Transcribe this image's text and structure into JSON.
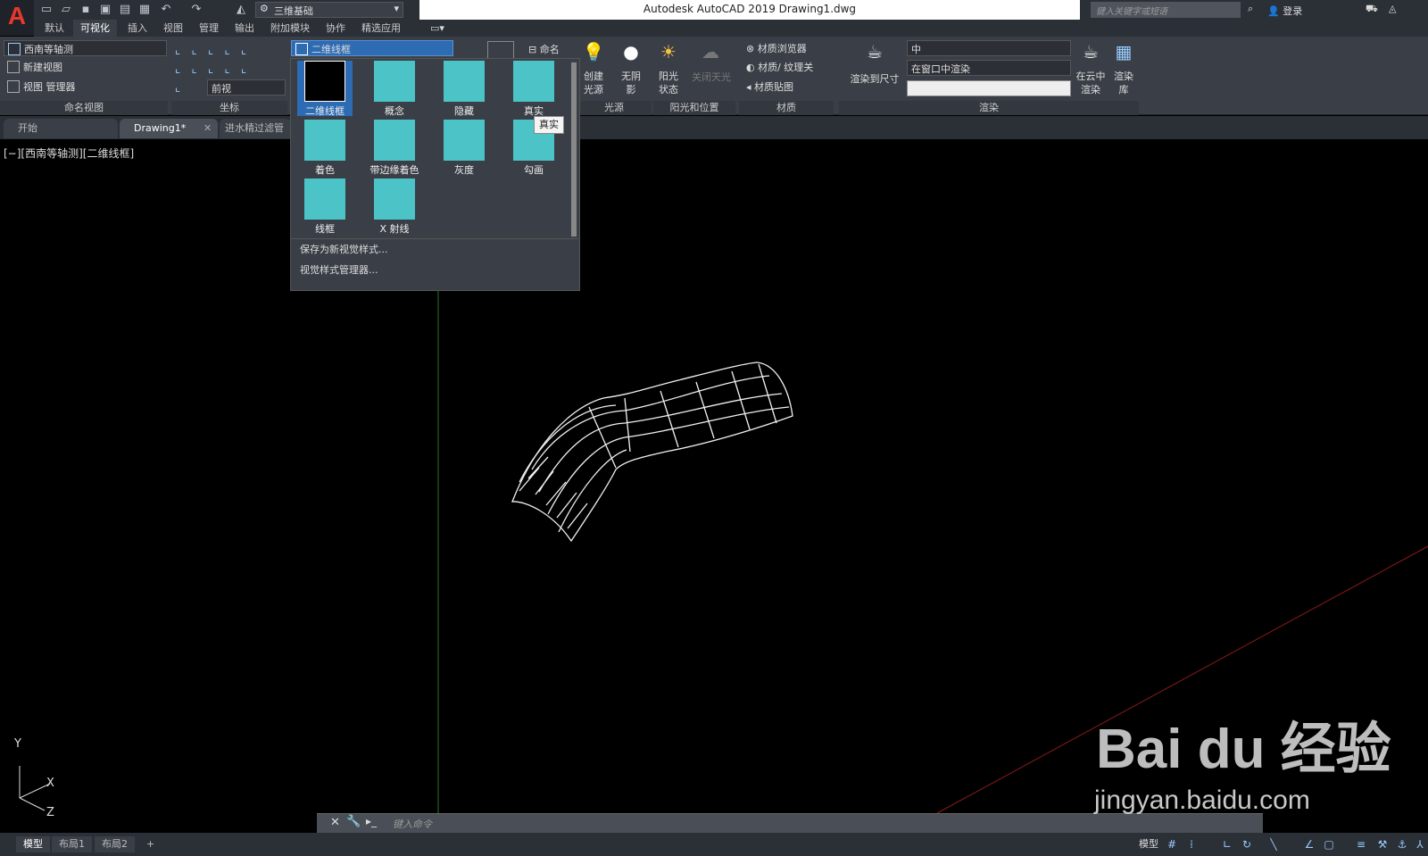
{
  "app": {
    "title": "Autodesk AutoCAD 2019    Drawing1.dwg",
    "workspace": "三维基础",
    "search_placeholder": "键入关键字或短语",
    "login": "登录"
  },
  "menu_tabs": [
    "默认",
    "可视化",
    "插入",
    "视图",
    "管理",
    "输出",
    "附加模块",
    "协作",
    "精选应用"
  ],
  "ribbon": {
    "named_views": {
      "view_select": "西南等轴测",
      "new_view": "新建视图",
      "view_manager": "视图 管理器",
      "label": "命名视图"
    },
    "coords": {
      "view_select": "前视",
      "label": "坐标"
    },
    "visual_style": {
      "select": "二维线框",
      "name_btn": "命名"
    },
    "lights": {
      "create": "创建光源",
      "shadow": "无阴影",
      "label": "光源"
    },
    "sun": {
      "status": "阳光状态",
      "sky": "关闭天光",
      "label": "阳光和位置"
    },
    "materials": {
      "browser": "材质浏览器",
      "texture": "材质/ 纹理关",
      "mapping": "材质贴图",
      "label": "材质"
    },
    "render": {
      "quality": "中",
      "target": "在窗口中渲染",
      "render_size": "渲染到尺寸",
      "cloud": "在云中渲染",
      "library": "渲染库",
      "label": "渲染"
    }
  },
  "file_tabs": [
    "开始",
    "Drawing1*",
    "进水精过滤管"
  ],
  "viewport_label": "[−][西南等轴测][二维线框]",
  "dropdown": {
    "styles": [
      {
        "label": "二维线框",
        "selected": true
      },
      {
        "label": "概念"
      },
      {
        "label": "隐藏"
      },
      {
        "label": "真实"
      },
      {
        "label": "着色"
      },
      {
        "label": "带边缘着色"
      },
      {
        "label": "灰度"
      },
      {
        "label": "勾画"
      },
      {
        "label": "线框"
      },
      {
        "label": "X 射线"
      }
    ],
    "save_new": "保存为新视觉样式...",
    "manager": "视觉样式管理器..."
  },
  "tooltip": "真实",
  "ucs": {
    "y": "Y",
    "x": "X",
    "z": "Z"
  },
  "command_placeholder": "键入命令",
  "status_tabs": [
    "模型",
    "布局1",
    "布局2",
    "+"
  ],
  "status_model": "模型",
  "watermark": {
    "brand": "Bai du 经验",
    "url": "jingyan.baidu.com"
  },
  "colors": {
    "accent": "#2d6bb3",
    "thumb": "#4cc3c7",
    "bg": "#000000"
  }
}
